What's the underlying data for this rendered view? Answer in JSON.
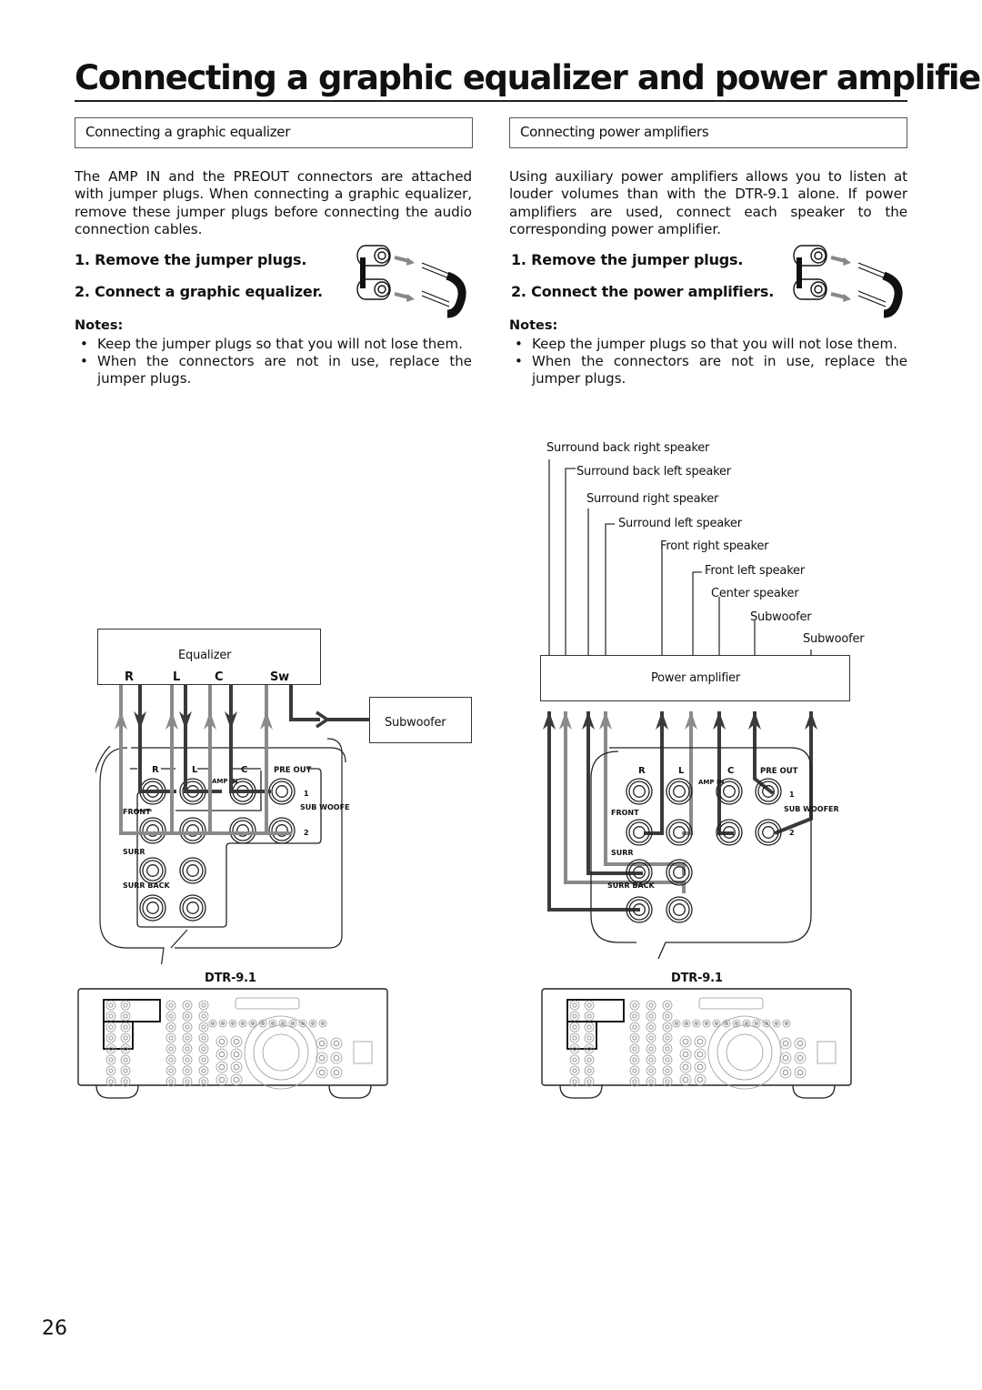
{
  "page": {
    "title": "Connecting a graphic equalizer and power amplifiers",
    "page_number": "26"
  },
  "left": {
    "heading": "Connecting a graphic equalizer",
    "intro": "The AMP IN and the PREOUT connectors are attached with jumper plugs. When connecting a graphic equalizer, remove these jumper plugs before connecting the audio connection cables.",
    "steps": [
      "1.  Remove the jumper plugs.",
      "2.  Connect a graphic equalizer."
    ],
    "notes_heading": "Notes:",
    "notes": [
      "Keep the jumper plugs so that you will not lose them.",
      "When the connectors are not in use, replace the jumper plugs."
    ],
    "diagram": {
      "equalizer_label": "Equalizer",
      "channels": [
        "R",
        "L",
        "C",
        "Sw"
      ],
      "subwoofer_label": "Subwoofer",
      "device_label": "DTR-9.1"
    }
  },
  "right": {
    "heading": "Connecting power amplifiers",
    "intro": "Using auxiliary power amplifiers allows you to listen at louder volumes than with the DTR-9.1 alone. If power amplifiers are used, connect each speaker to the corresponding power amplifier.",
    "steps": [
      "1.  Remove the jumper plugs.",
      "2.  Connect the power amplifiers."
    ],
    "notes_heading": "Notes:",
    "notes": [
      "Keep the jumper plugs so that you will not lose them.",
      "When the connectors are not in use, replace the jumper plugs."
    ],
    "diagram": {
      "speakers": [
        "Surround back right speaker",
        "Surround back left speaker",
        "Surround right speaker",
        "Surround left speaker",
        "Front right speaker",
        "Front left speaker",
        "Center speaker",
        "Subwoofer",
        "Subwoofer"
      ],
      "power_amp_label": "Power amplifier",
      "device_label": "DTR-9.1"
    }
  },
  "panel": {
    "r": "R",
    "l": "L",
    "c": "C",
    "pre_out": "PRE OUT",
    "amp_in": "AMP IN",
    "front": "FRONT",
    "surr": "SURR",
    "surr_back": "SURR BACK",
    "sub_woofer": "SUB WOOFER",
    "one": "1",
    "two": "2"
  },
  "colors": {
    "dark_cable": "#3a3a3a",
    "light_cable": "#8a8a8a",
    "arrow_grey": "#888888"
  }
}
